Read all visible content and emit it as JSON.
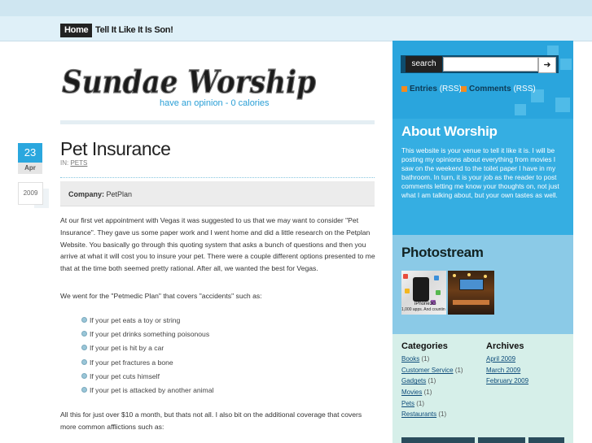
{
  "nav": {
    "home": "Home",
    "link": "Tell It Like It Is Son!"
  },
  "header": {
    "logo_text": "Sundae Worship",
    "tagline": "have an opinion - 0 calories"
  },
  "post": {
    "date_day": "23",
    "date_month": "Apr",
    "date_year": "2009",
    "title": "Pet Insurance",
    "in_label": "IN:",
    "category": "PETS",
    "company_label": "Company:",
    "company_value": "PetPlan",
    "para1": "At our first vet appointment with Vegas it was suggested to us that we may want to consider \"Pet Insurance\". They gave us some paper work and I went home and did a little research on the Petplan Website. You basically go through this quoting system that asks a bunch of questions and then you arrive at what it will cost you to insure your pet. There were a couple different options presented to me that at the time both seemed pretty rational. After all, we wanted the best for Vegas.",
    "para2": "We went for the \"Petmedic Plan\" that covers \"accidents\" such as:",
    "list": [
      "If your pet eats a toy or string",
      "If your pet drinks something poisonous",
      "If your pet is hit by a car",
      "If your pet fractures a bone",
      "If your pet cuts himself",
      "If your pet is attacked by another animal"
    ],
    "para3": "All this for just over $10 a month, but thats not all. I also bit on the additional coverage that covers more common afflictions such as:"
  },
  "sidebar": {
    "search_label": "search",
    "search_button": "➜",
    "entries": "Entries",
    "comments": "Comments",
    "rss": "(RSS)",
    "about_title": "About Worship",
    "about_text": "This website is your venue to tell it like it is. I will be posting my opinions about everything from movies I saw on the weekend to the toilet paper I have in my bathroom. In turn, it is your job as the reader to post comments letting me know your thoughts on, not just what I am talking about, but your own tastes as well.",
    "photostream_title": "Photostream",
    "photo1_caption1": "iPhone3G",
    "photo1_caption2": "1,000 apps. And countin",
    "categories_title": "Categories",
    "categories": [
      {
        "name": "Books",
        "count": "(1)"
      },
      {
        "name": "Customer Service",
        "count": "(1)"
      },
      {
        "name": "Gadgets",
        "count": "(1)"
      },
      {
        "name": "Movies",
        "count": "(1)"
      },
      {
        "name": "Pets",
        "count": "(1)"
      },
      {
        "name": "Restaurants",
        "count": "(1)"
      }
    ],
    "archives_title": "Archives",
    "archives": [
      "April 2009",
      "March 2009",
      "February 2009"
    ]
  },
  "colors": {
    "accent": "#2aa7de",
    "sidebar_blue": "#35aee2",
    "sidebar_green": "#d6efe9",
    "rss_orange": "#f38a1d"
  }
}
